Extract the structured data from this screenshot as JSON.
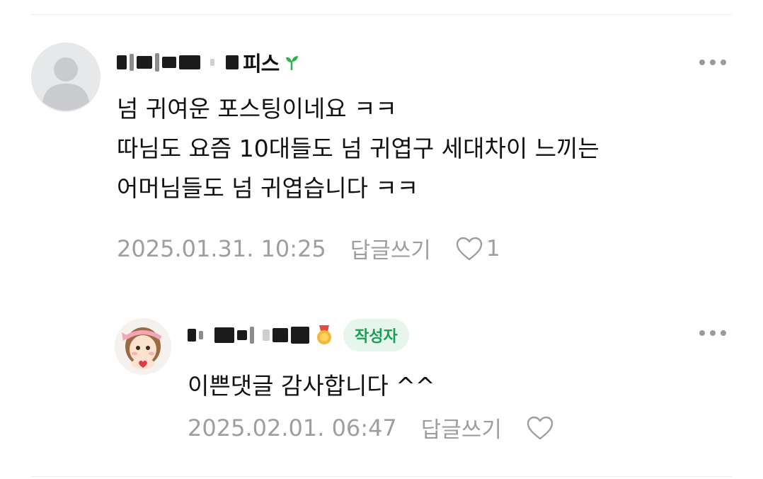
{
  "comments": [
    {
      "author_suffix": "피스",
      "body_lines": [
        "넘 귀여운 포스팅이네요 ㅋㅋ",
        "따님도 요즘 10대들도 넘 귀엽구 세대차이 느끼는",
        "어머님들도 넘 귀엽습니다 ㅋㅋ"
      ],
      "date": "2025.01.31. 10:25",
      "reply_label": "답글쓰기",
      "like_count": "1",
      "avatar": "default-person-icon",
      "badge_icon": "sprout-icon"
    },
    {
      "author_suffix": "",
      "author_badge": "작성자",
      "body_lines": [
        "이쁜댓글 감사합니다 ^^"
      ],
      "date": "2025.02.01. 06:47",
      "reply_label": "답글쓰기",
      "like_count": "",
      "avatar": "cartoon-girl-avatar",
      "badge_icon": "medal-icon"
    }
  ],
  "colors": {
    "accent_green": "#19a055",
    "badge_bg": "#e6f6ec",
    "meta_gray": "#9e9e9e",
    "sprout_green": "#2fb24c"
  }
}
